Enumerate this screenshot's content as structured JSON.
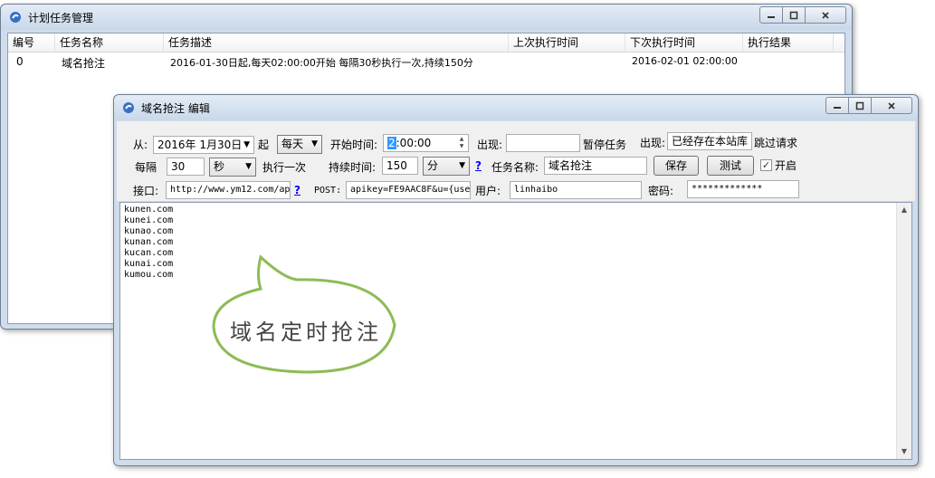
{
  "main_window": {
    "title": "计划任务管理",
    "controls": {
      "min": "▭",
      "max": "▢",
      "close": "✕"
    },
    "columns": [
      "编号",
      "任务名称",
      "任务描述",
      "上次执行时间",
      "下次执行时间",
      "执行结果"
    ],
    "rows": [
      {
        "id": "0",
        "name": "域名抢注",
        "desc": "2016-01-30日起,每天02:00:00开始 每隔30秒执行一次,持续150分",
        "last": "",
        "next": "2016-02-01 02:00:00",
        "result": ""
      }
    ]
  },
  "edit_window": {
    "title": "域名抢注 编辑",
    "from_label": "从:",
    "from_date": "2016年 1月30日",
    "qi_label": "起",
    "freq_select": "每天",
    "start_time_label": "开始时间:",
    "start_time_hour": "2",
    "start_time_rest": ":00:00",
    "appear1_label": "出现:",
    "appear1_value": "",
    "pause_label": "暂停任务",
    "appear2_label": "出现:",
    "appear2_value": "已经存在本站库",
    "skip_label": "跳过请求",
    "interval_label": "每隔",
    "interval_value": "30",
    "interval_unit": "秒",
    "exec_once_label": "执行一次",
    "duration_label": "持续时间:",
    "duration_value": "150",
    "duration_unit": "分",
    "help_mark": "?",
    "task_name_label": "任务名称:",
    "task_name_value": "域名抢注",
    "save_label": "保存",
    "test_label": "测试",
    "enable_label": "开启",
    "enable_checked": "✓",
    "api_label": "接口:",
    "api_value": "http://www.ym12.com/ap",
    "post_label": "POST:",
    "post_value": "apikey=FE9AAC8F&u={use",
    "user_label": "用户:",
    "user_value": "linhaibo",
    "pwd_label": "密码:",
    "pwd_value": "*************",
    "domains": [
      "kunen.com",
      "kunei.com",
      "kunao.com",
      "kunan.com",
      "kucan.com",
      "kunai.com",
      "kumou.com"
    ],
    "bubble_text": "域名定时抢注"
  },
  "colors": {
    "accent": "#3a6fc4",
    "bubble_stroke": "#8dbb55",
    "selection": "#3399ff"
  }
}
